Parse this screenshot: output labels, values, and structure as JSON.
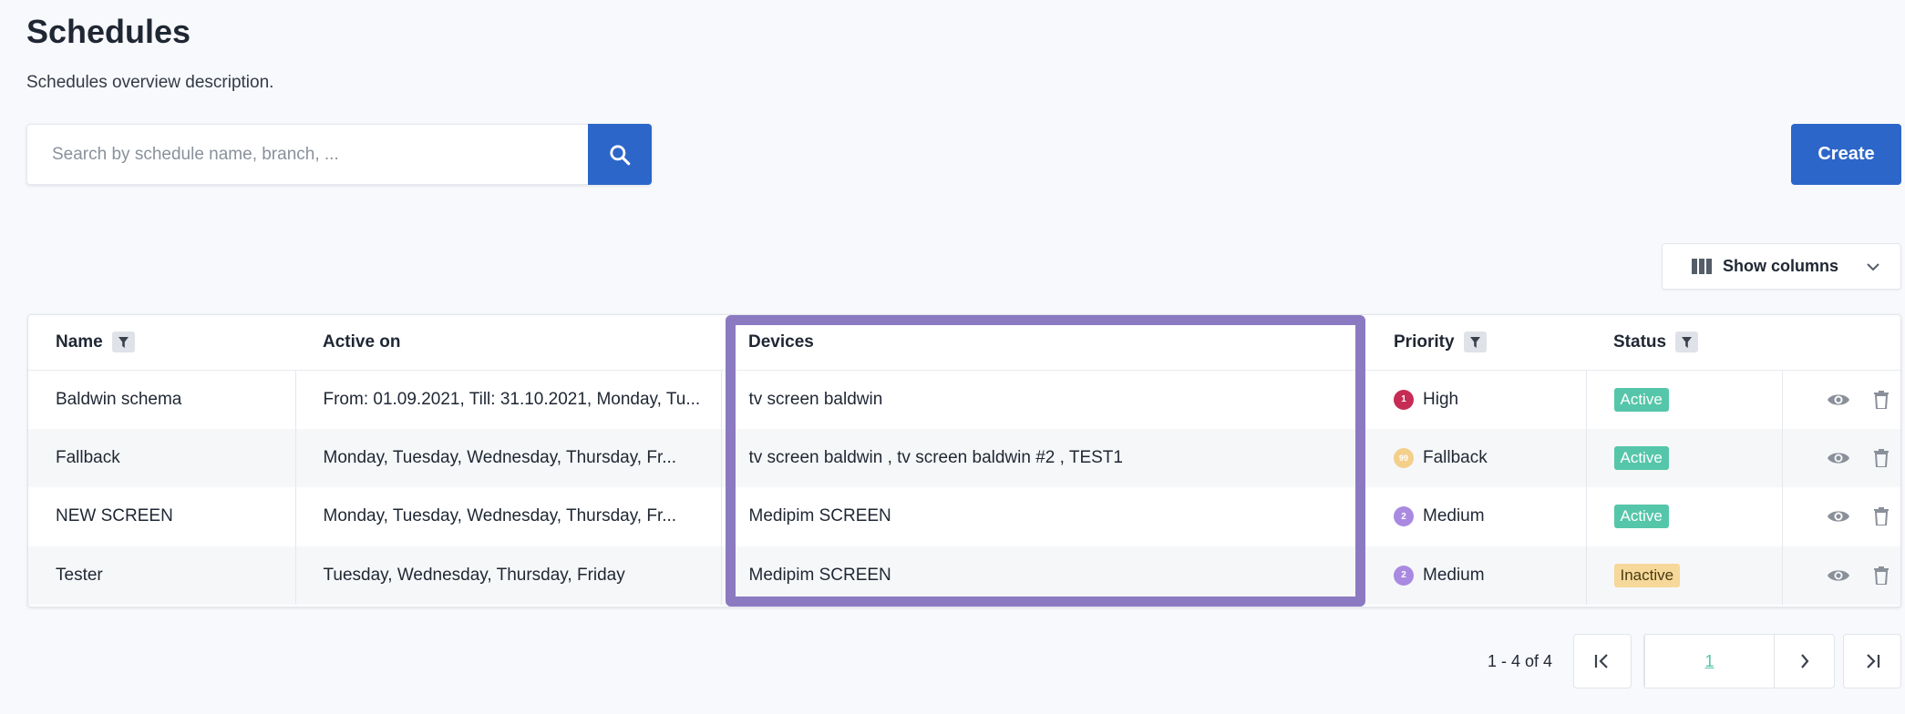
{
  "page": {
    "title": "Schedules",
    "description": "Schedules overview description."
  },
  "search": {
    "placeholder": "Search by schedule name, branch, ...",
    "value": ""
  },
  "toolbar": {
    "create_label": "Create",
    "show_columns_label": "Show columns"
  },
  "table": {
    "columns": [
      "Name",
      "Active on",
      "Devices",
      "Priority",
      "Status"
    ],
    "rows": [
      {
        "name": "Baldwin schema",
        "active_on": "From: 01.09.2021, Till: 31.10.2021, Monday, Tu...",
        "devices": "tv screen baldwin",
        "priority_num": "1",
        "priority": "High",
        "status": "Active"
      },
      {
        "name": "Fallback",
        "active_on": "Monday, Tuesday, Wednesday, Thursday, Fr...",
        "devices": "tv screen baldwin , tv screen baldwin #2 , TEST1",
        "priority_num": "99",
        "priority": "Fallback",
        "status": "Active"
      },
      {
        "name": "NEW SCREEN",
        "active_on": "Monday, Tuesday, Wednesday, Thursday, Fr...",
        "devices": "Medipim SCREEN",
        "priority_num": "2",
        "priority": "Medium",
        "status": "Active"
      },
      {
        "name": "Tester",
        "active_on": "Tuesday, Wednesday, Thursday, Friday",
        "devices": "Medipim SCREEN",
        "priority_num": "2",
        "priority": "Medium",
        "status": "Inactive"
      }
    ]
  },
  "pagination": {
    "range_text": "1 - 4 of 4",
    "current_page": "1"
  },
  "colors": {
    "primary": "#2d66c9",
    "highlight": "#8b7ac2",
    "active": "#55c6a9",
    "inactive": "#f5d89a",
    "priority_high": "#c72c55",
    "priority_fallback": "#f3cf8a",
    "priority_medium": "#a98ae0"
  }
}
